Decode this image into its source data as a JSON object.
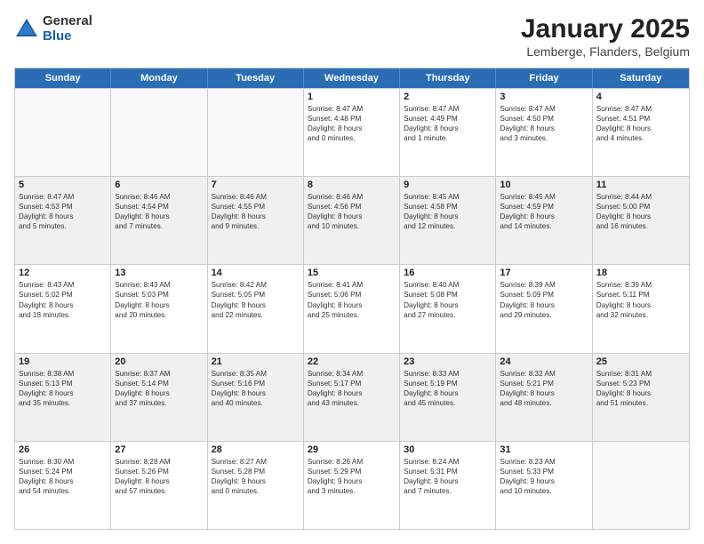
{
  "logo": {
    "general": "General",
    "blue": "Blue"
  },
  "title": "January 2025",
  "subtitle": "Lemberge, Flanders, Belgium",
  "days": [
    "Sunday",
    "Monday",
    "Tuesday",
    "Wednesday",
    "Thursday",
    "Friday",
    "Saturday"
  ],
  "rows": [
    [
      {
        "day": "",
        "lines": []
      },
      {
        "day": "",
        "lines": []
      },
      {
        "day": "",
        "lines": []
      },
      {
        "day": "1",
        "lines": [
          "Sunrise: 8:47 AM",
          "Sunset: 4:48 PM",
          "Daylight: 8 hours",
          "and 0 minutes."
        ]
      },
      {
        "day": "2",
        "lines": [
          "Sunrise: 8:47 AM",
          "Sunset: 4:49 PM",
          "Daylight: 8 hours",
          "and 1 minute."
        ]
      },
      {
        "day": "3",
        "lines": [
          "Sunrise: 8:47 AM",
          "Sunset: 4:50 PM",
          "Daylight: 8 hours",
          "and 3 minutes."
        ]
      },
      {
        "day": "4",
        "lines": [
          "Sunrise: 8:47 AM",
          "Sunset: 4:51 PM",
          "Daylight: 8 hours",
          "and 4 minutes."
        ]
      }
    ],
    [
      {
        "day": "5",
        "lines": [
          "Sunrise: 8:47 AM",
          "Sunset: 4:53 PM",
          "Daylight: 8 hours",
          "and 5 minutes."
        ]
      },
      {
        "day": "6",
        "lines": [
          "Sunrise: 8:46 AM",
          "Sunset: 4:54 PM",
          "Daylight: 8 hours",
          "and 7 minutes."
        ]
      },
      {
        "day": "7",
        "lines": [
          "Sunrise: 8:46 AM",
          "Sunset: 4:55 PM",
          "Daylight: 8 hours",
          "and 9 minutes."
        ]
      },
      {
        "day": "8",
        "lines": [
          "Sunrise: 8:46 AM",
          "Sunset: 4:56 PM",
          "Daylight: 8 hours",
          "and 10 minutes."
        ]
      },
      {
        "day": "9",
        "lines": [
          "Sunrise: 8:45 AM",
          "Sunset: 4:58 PM",
          "Daylight: 8 hours",
          "and 12 minutes."
        ]
      },
      {
        "day": "10",
        "lines": [
          "Sunrise: 8:45 AM",
          "Sunset: 4:59 PM",
          "Daylight: 8 hours",
          "and 14 minutes."
        ]
      },
      {
        "day": "11",
        "lines": [
          "Sunrise: 8:44 AM",
          "Sunset: 5:00 PM",
          "Daylight: 8 hours",
          "and 16 minutes."
        ]
      }
    ],
    [
      {
        "day": "12",
        "lines": [
          "Sunrise: 8:43 AM",
          "Sunset: 5:02 PM",
          "Daylight: 8 hours",
          "and 18 minutes."
        ]
      },
      {
        "day": "13",
        "lines": [
          "Sunrise: 8:43 AM",
          "Sunset: 5:03 PM",
          "Daylight: 8 hours",
          "and 20 minutes."
        ]
      },
      {
        "day": "14",
        "lines": [
          "Sunrise: 8:42 AM",
          "Sunset: 5:05 PM",
          "Daylight: 8 hours",
          "and 22 minutes."
        ]
      },
      {
        "day": "15",
        "lines": [
          "Sunrise: 8:41 AM",
          "Sunset: 5:06 PM",
          "Daylight: 8 hours",
          "and 25 minutes."
        ]
      },
      {
        "day": "16",
        "lines": [
          "Sunrise: 8:40 AM",
          "Sunset: 5:08 PM",
          "Daylight: 8 hours",
          "and 27 minutes."
        ]
      },
      {
        "day": "17",
        "lines": [
          "Sunrise: 8:39 AM",
          "Sunset: 5:09 PM",
          "Daylight: 8 hours",
          "and 29 minutes."
        ]
      },
      {
        "day": "18",
        "lines": [
          "Sunrise: 8:39 AM",
          "Sunset: 5:11 PM",
          "Daylight: 8 hours",
          "and 32 minutes."
        ]
      }
    ],
    [
      {
        "day": "19",
        "lines": [
          "Sunrise: 8:38 AM",
          "Sunset: 5:13 PM",
          "Daylight: 8 hours",
          "and 35 minutes."
        ]
      },
      {
        "day": "20",
        "lines": [
          "Sunrise: 8:37 AM",
          "Sunset: 5:14 PM",
          "Daylight: 8 hours",
          "and 37 minutes."
        ]
      },
      {
        "day": "21",
        "lines": [
          "Sunrise: 8:35 AM",
          "Sunset: 5:16 PM",
          "Daylight: 8 hours",
          "and 40 minutes."
        ]
      },
      {
        "day": "22",
        "lines": [
          "Sunrise: 8:34 AM",
          "Sunset: 5:17 PM",
          "Daylight: 8 hours",
          "and 43 minutes."
        ]
      },
      {
        "day": "23",
        "lines": [
          "Sunrise: 8:33 AM",
          "Sunset: 5:19 PM",
          "Daylight: 8 hours",
          "and 45 minutes."
        ]
      },
      {
        "day": "24",
        "lines": [
          "Sunrise: 8:32 AM",
          "Sunset: 5:21 PM",
          "Daylight: 8 hours",
          "and 48 minutes."
        ]
      },
      {
        "day": "25",
        "lines": [
          "Sunrise: 8:31 AM",
          "Sunset: 5:23 PM",
          "Daylight: 8 hours",
          "and 51 minutes."
        ]
      }
    ],
    [
      {
        "day": "26",
        "lines": [
          "Sunrise: 8:30 AM",
          "Sunset: 5:24 PM",
          "Daylight: 8 hours",
          "and 54 minutes."
        ]
      },
      {
        "day": "27",
        "lines": [
          "Sunrise: 8:28 AM",
          "Sunset: 5:26 PM",
          "Daylight: 8 hours",
          "and 57 minutes."
        ]
      },
      {
        "day": "28",
        "lines": [
          "Sunrise: 8:27 AM",
          "Sunset: 5:28 PM",
          "Daylight: 9 hours",
          "and 0 minutes."
        ]
      },
      {
        "day": "29",
        "lines": [
          "Sunrise: 8:26 AM",
          "Sunset: 5:29 PM",
          "Daylight: 9 hours",
          "and 3 minutes."
        ]
      },
      {
        "day": "30",
        "lines": [
          "Sunrise: 8:24 AM",
          "Sunset: 5:31 PM",
          "Daylight: 9 hours",
          "and 7 minutes."
        ]
      },
      {
        "day": "31",
        "lines": [
          "Sunrise: 8:23 AM",
          "Sunset: 5:33 PM",
          "Daylight: 9 hours",
          "and 10 minutes."
        ]
      },
      {
        "day": "",
        "lines": []
      }
    ]
  ]
}
